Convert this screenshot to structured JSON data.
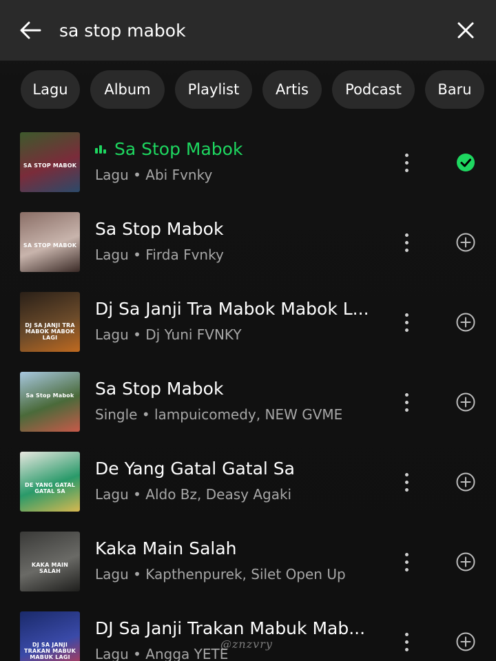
{
  "search": {
    "query": "sa stop mabok",
    "back_icon": "arrow-left-icon",
    "clear_icon": "close-icon"
  },
  "filters": [
    {
      "label": "Lagu"
    },
    {
      "label": "Album"
    },
    {
      "label": "Playlist"
    },
    {
      "label": "Artis"
    },
    {
      "label": "Podcast"
    },
    {
      "label": "Baru"
    }
  ],
  "results": [
    {
      "title": "Sa Stop Mabok",
      "subtitle": "Lagu • Abi Fvnky",
      "cover_text": "SA STOP MABOK",
      "cover_colors": [
        "#3d5a2c",
        "#7a2c3a",
        "#2b4a6a"
      ],
      "playing": true,
      "action": "added",
      "action_icon": "check-circle-icon"
    },
    {
      "title": "Sa Stop Mabok",
      "subtitle": "Lagu • Firda Fvnky",
      "cover_text": "SA STOP MABOK",
      "cover_colors": [
        "#8a6e66",
        "#c8b4ac",
        "#3a2a26"
      ],
      "playing": false,
      "action": "add",
      "action_icon": "plus-circle-icon"
    },
    {
      "title": "Dj Sa Janji Tra Mabok Mabok L...",
      "subtitle": "Lagu • Dj Yuni FVNKY",
      "cover_text": "DJ SA JANJI TRA MABOK MABOK LAGI",
      "cover_colors": [
        "#2a2018",
        "#6a4a2a",
        "#c06a20"
      ],
      "playing": false,
      "action": "add",
      "action_icon": "plus-circle-icon"
    },
    {
      "title": "Sa Stop Mabok",
      "subtitle": "Single • lampuicomedy, NEW GVME",
      "cover_text": "Sa Stop Mabok",
      "cover_colors": [
        "#a8c8e0",
        "#4a6a3a",
        "#c85a4a"
      ],
      "playing": false,
      "action": "add",
      "action_icon": "plus-circle-icon"
    },
    {
      "title": "De Yang Gatal Gatal Sa",
      "subtitle": "Lagu • Aldo Bz, Deasy Agaki",
      "cover_text": "DE YANG GATAL GATAL SA",
      "cover_colors": [
        "#e8e8e0",
        "#2a9a6a",
        "#d8b850"
      ],
      "playing": false,
      "action": "add",
      "action_icon": "plus-circle-icon"
    },
    {
      "title": "Kaka Main Salah",
      "subtitle": "Lagu • Kapthenpurek, Silet Open Up",
      "cover_text": "KAKA MAIN SALAH",
      "cover_colors": [
        "#3a3a38",
        "#6a6a66",
        "#1e1e1c"
      ],
      "playing": false,
      "action": "add",
      "action_icon": "plus-circle-icon"
    },
    {
      "title": "DJ Sa Janji Trakan Mabuk Mab...",
      "subtitle": "Lagu • Angga YETE",
      "cover_text": "DJ SA JANJI TRAKAN MABUK MABUK LAGI",
      "cover_colors": [
        "#1a2a6a",
        "#3a4aa8",
        "#c83a4a"
      ],
      "playing": false,
      "action": "add",
      "action_icon": "plus-circle-icon"
    }
  ],
  "watermark": "@znzvry",
  "colors": {
    "accent": "#1ed760",
    "background": "#121212",
    "header": "#2a2a2a",
    "chip": "#2a2a2a",
    "subtext": "#a7a7a7"
  }
}
